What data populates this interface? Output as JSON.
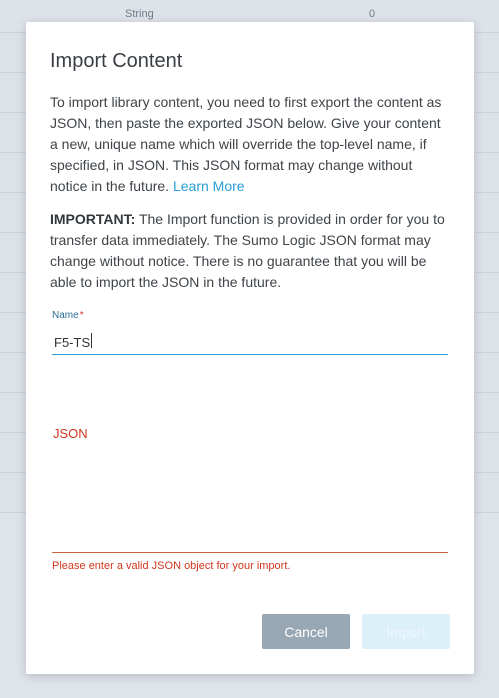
{
  "background": {
    "first_row": {
      "type": "String",
      "count": "0"
    },
    "row_count": 12
  },
  "modal": {
    "title": "Import Content",
    "description": "To import library content, you need to first export the content as JSON, then paste the exported JSON below. Give your content a new, unique name which will override the top-level name, if specified, in JSON. This JSON format may change without notice in the future.",
    "learn_more": "Learn More",
    "important_label": "IMPORTANT:",
    "important_text": "The Import function is provided in order for you to transfer data immediately. The Sumo Logic JSON format may change without notice. There is no guarantee that you will be able to import the JSON in the future.",
    "name_label": "Name",
    "name_required_mark": "*",
    "name_value": "F5-TS",
    "json_label": "JSON",
    "json_value": "",
    "json_error": "Please enter a valid JSON object for your import.",
    "cancel_label": "Cancel",
    "import_label": "Import"
  },
  "colors": {
    "accent": "#2a9fd8",
    "error": "#d0361e",
    "cancel_bg": "#98a7b4",
    "import_disabled_bg": "#dcf0fa"
  }
}
